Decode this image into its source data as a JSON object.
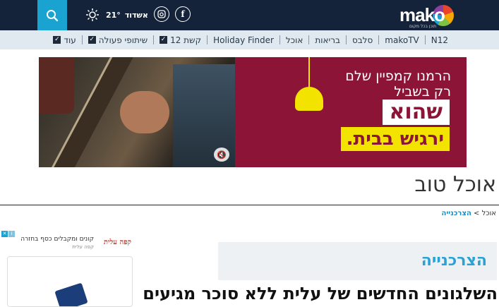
{
  "header": {
    "logo_text": "mako",
    "logo_tagline": "תוכן בכל מקום",
    "weather_city": "אשדוד",
    "weather_temp": "21°",
    "social": [
      "f",
      "ig"
    ]
  },
  "nav": {
    "items": [
      {
        "label": "N12",
        "dropdown": false
      },
      {
        "label": "makoTV",
        "dropdown": false
      },
      {
        "label": "סלבס",
        "dropdown": false
      },
      {
        "label": "בריאות",
        "dropdown": false
      },
      {
        "label": "אוכל",
        "dropdown": false
      },
      {
        "label": "Holiday Finder",
        "dropdown": false
      },
      {
        "label": "קשת 12",
        "dropdown": true
      },
      {
        "label": "שיתופי פעולה",
        "dropdown": true
      },
      {
        "label": "עוד",
        "dropdown": true
      }
    ]
  },
  "banner_ad": {
    "line1": "הרמנו קמפיין שלם",
    "line2": "רק בשביל",
    "big": "שהוא",
    "yellow": "ירגיש בבית."
  },
  "section": {
    "title": "אוכל טוב"
  },
  "breadcrumb": {
    "parent": "אוכל",
    "separator": ">",
    "current": "הצרכנייה"
  },
  "side_ad": {
    "title": "קונים ומקבלים כסף בחזרה",
    "brand": "קפה עלית",
    "logo": "קפה עלית"
  },
  "category": {
    "title": "הצרכנייה"
  },
  "article": {
    "headline": "השלגונים החדשים של עלית ללא סוכר מגיעים"
  },
  "colors": {
    "header_bg": "#14233a",
    "accent": "#1aa3d0",
    "ad_bg": "#8c1537",
    "ad_yellow": "#f2e400"
  }
}
